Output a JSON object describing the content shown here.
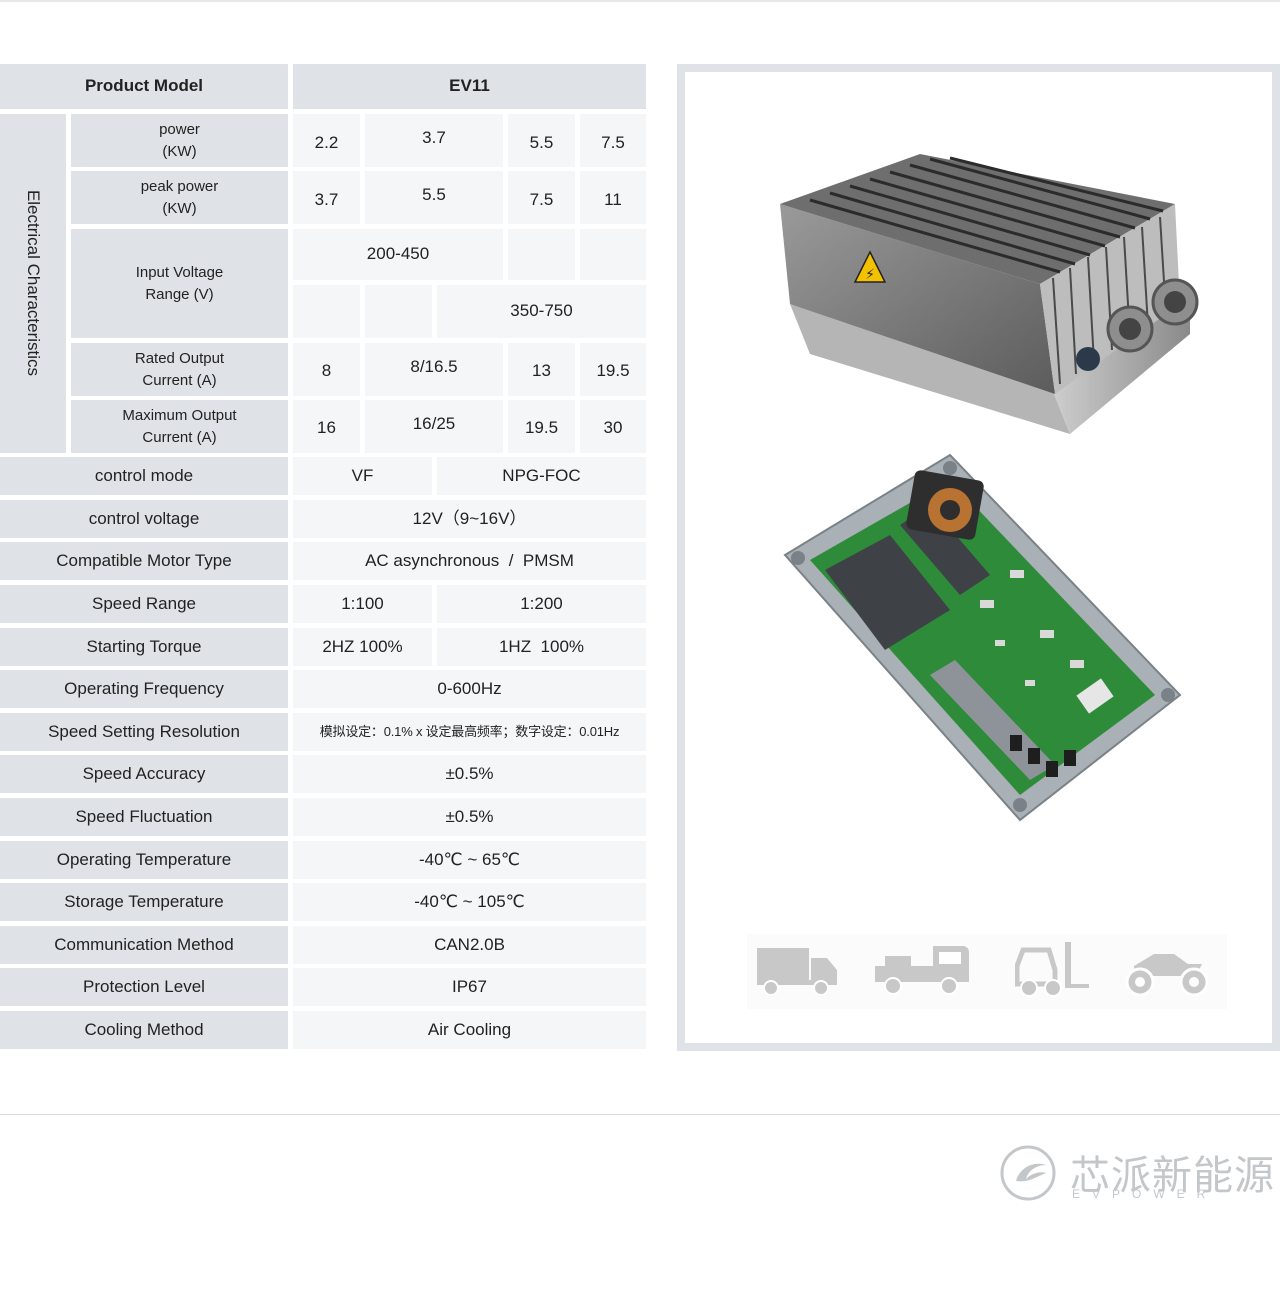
{
  "table": {
    "header": {
      "label": "Product Model",
      "model": "EV11"
    },
    "group_label": "Electrical Characteristics",
    "electrical": {
      "power": {
        "label_1": "power",
        "label_2": "(KW)",
        "values": [
          "2.2",
          "3.7",
          "5.5",
          "7.5"
        ]
      },
      "peak_power": {
        "label_1": "peak power",
        "label_2": "(KW)",
        "values": [
          "3.7",
          "5.5",
          "7.5",
          "11"
        ]
      },
      "input_voltage": {
        "label_1": "Input Voltage",
        "label_2": "Range (V)",
        "low": "200-450",
        "high": "350-750"
      },
      "rated_current": {
        "label_1": "Rated Output",
        "label_2": "Current (A)",
        "values": [
          "8",
          "8/16.5",
          "13",
          "19.5"
        ]
      },
      "max_current": {
        "label_1": "Maximum Output",
        "label_2": "Current (A)",
        "values": [
          "16",
          "16/25",
          "19.5",
          "30"
        ]
      }
    },
    "rows": {
      "control_mode": {
        "label": "control mode",
        "a": "VF",
        "b": "NPG-FOC"
      },
      "control_voltage": {
        "label": "control voltage",
        "value": "12V（9~16V）"
      },
      "motor_type": {
        "label": "Compatible Motor Type",
        "value": "AC asynchronous  /  PMSM"
      },
      "speed_range": {
        "label": "Speed Range",
        "a": "1:100",
        "b": "1:200"
      },
      "starting_torque": {
        "label": "Starting Torque",
        "a": "2HZ 100%",
        "b": "1HZ  100%"
      },
      "operating_frequency": {
        "label": "Operating Frequency",
        "value": "0-600Hz"
      },
      "speed_setting_resolution": {
        "label": "Speed Setting Resolution",
        "value": "模拟设定：0.1% x 设定最高频率；数字设定：0.01Hz"
      },
      "speed_accuracy": {
        "label": "Speed Accuracy",
        "value": "±0.5%"
      },
      "speed_fluctuation": {
        "label": "Speed Fluctuation",
        "value": "±0.5%"
      },
      "operating_temperature": {
        "label": "Operating Temperature",
        "value": "-40℃ ~ 65℃"
      },
      "storage_temperature": {
        "label": "Storage Temperature",
        "value": "-40℃ ~ 105℃"
      },
      "communication_method": {
        "label": "Communication Method",
        "value": "CAN2.0B"
      },
      "protection_level": {
        "label": "Protection Level",
        "value": "IP67"
      },
      "cooling_method": {
        "label": "Cooling Method",
        "value": "Air Cooling"
      }
    }
  },
  "product_panel": {
    "images": [
      "controller-housing-image",
      "controller-circuit-board-image"
    ],
    "applications": [
      "truck-icon",
      "flatbed-truck-icon",
      "forklift-icon",
      "atv-icon"
    ]
  },
  "brand": {
    "name_cn": "芯派新能源",
    "name_en": "EVPOWER",
    "logo_icon": "evpower-logo-icon"
  },
  "colors": {
    "header_bg": "#dfe3e8",
    "value_bg": "#f5f6f7",
    "pcb_green": "#2e8b3a",
    "icon_gray": "#c8c8c8"
  }
}
